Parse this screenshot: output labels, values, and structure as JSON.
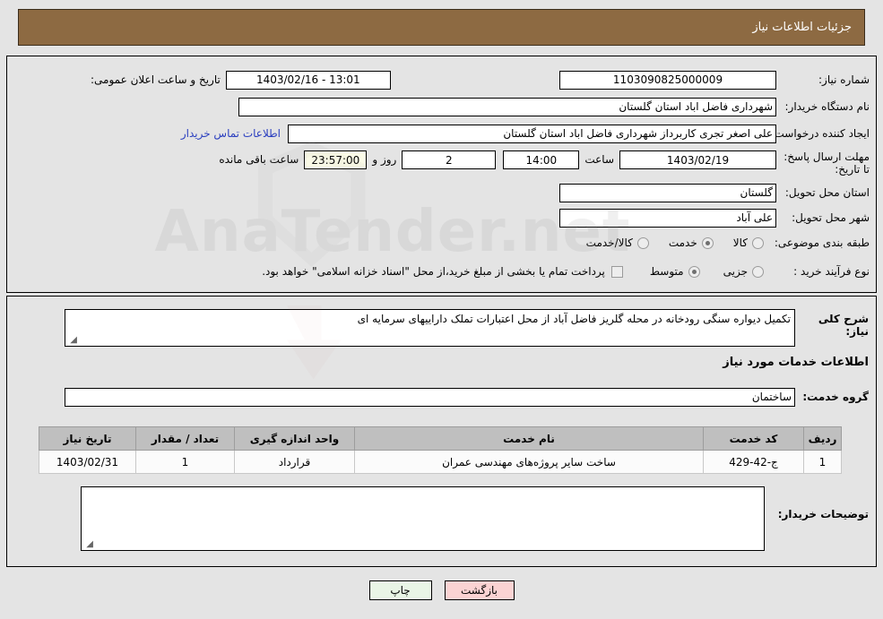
{
  "header": {
    "title": "جزئیات اطلاعات نیاز"
  },
  "watermark": {
    "text": "AnaTender.net"
  },
  "form": {
    "need_number_label": "شماره نیاز:",
    "need_number_value": "1103090825000009",
    "public_announce_label": "تاریخ و ساعت اعلان عمومی:",
    "public_announce_value": "13:01 - 1403/02/16",
    "buyer_org_label": "نام دستگاه خریدار:",
    "buyer_org_value": "شهرداری فاضل اباد استان گلستان",
    "creator_label": "ایجاد کننده درخواست:",
    "creator_value": "علی اصغر تجری کاربرداز شهرداری فاضل اباد استان گلستان",
    "contact_link": "اطلاعات تماس خریدار",
    "deadline_label": "مهلت ارسال پاسخ: تا تاریخ:",
    "deadline_date": "1403/02/19",
    "hour_label": "ساعت",
    "deadline_hour": "14:00",
    "days_remaining": "2",
    "days_label": "روز و",
    "time_remaining": "23:57:00",
    "remaining_label": "ساعت باقی مانده",
    "province_label": "استان محل تحویل:",
    "province_value": "گلستان",
    "city_label": "شهر محل تحویل:",
    "city_value": "علی آباد",
    "classification_label": "طبقه بندی موضوعی:",
    "classification_options": [
      {
        "label": "کالا",
        "selected": false
      },
      {
        "label": "خدمت",
        "selected": true
      },
      {
        "label": "کالا/خدمت",
        "selected": false
      }
    ],
    "process_type_label": "نوع فرآیند خرید :",
    "process_type_options": [
      {
        "label": "جزیی",
        "selected": false
      },
      {
        "label": "متوسط",
        "selected": true
      }
    ],
    "treasury_checkbox_checked": false,
    "treasury_note": "پرداخت تمام یا بخشی از مبلغ خرید،از محل \"اسناد خزانه اسلامی\" خواهد بود."
  },
  "description": {
    "label": "شرح کلی نیاز:",
    "value": "تکمیل دیواره سنگی رودخانه در محله گلریز فاضل آباد از محل اعتبارات تملک داراییهای سرمایه ای"
  },
  "services": {
    "section_title": "اطلاعات خدمات مورد نیاز",
    "group_label": "گروه خدمت:",
    "group_value": "ساختمان",
    "columns": [
      "ردیف",
      "کد خدمت",
      "نام خدمت",
      "واحد اندازه گیری",
      "تعداد / مقدار",
      "تاریخ نیاز"
    ],
    "rows": [
      {
        "index": "1",
        "code": "ج-42-429",
        "name": "ساخت سایر پروژه‌های مهندسی عمران",
        "unit": "قرارداد",
        "quantity": "1",
        "date": "1403/02/31"
      }
    ]
  },
  "buyer_comments": {
    "label": "توضیحات خریدار:",
    "value": ""
  },
  "buttons": {
    "print": "چاپ",
    "back": "بازگشت"
  }
}
